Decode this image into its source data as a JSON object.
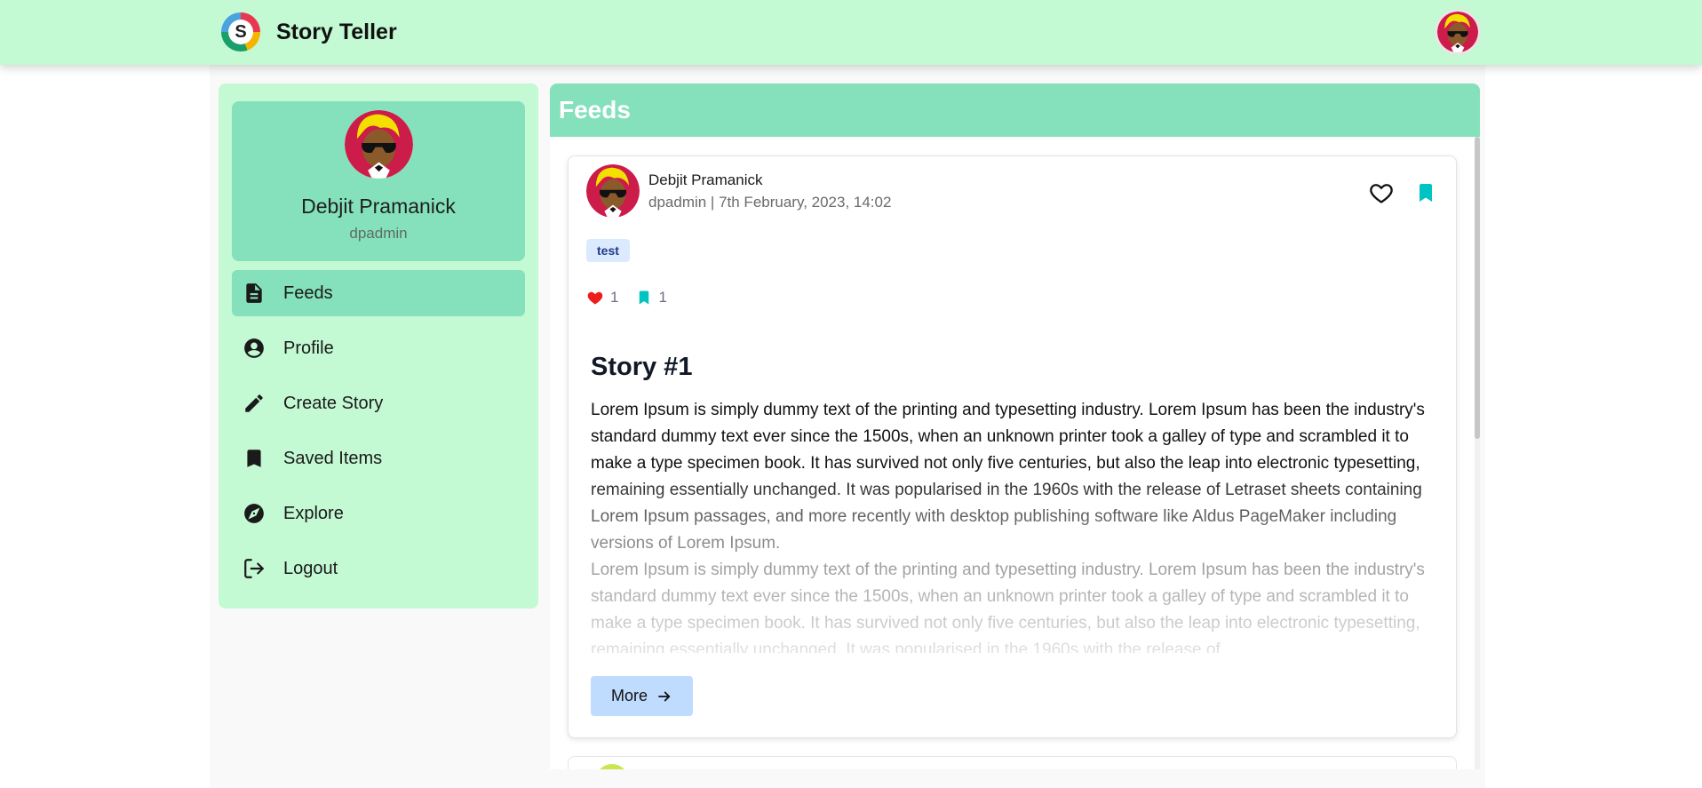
{
  "app": {
    "name": "Story Teller",
    "logo_letter": "S"
  },
  "user": {
    "name": "Debjit Pramanick",
    "username": "dpadmin"
  },
  "sidebar": {
    "items": [
      {
        "label": "Feeds",
        "icon": "document-icon",
        "active": true
      },
      {
        "label": "Profile",
        "icon": "account-circle-icon"
      },
      {
        "label": "Create Story",
        "icon": "pencil-icon"
      },
      {
        "label": "Saved Items",
        "icon": "bookmark-icon"
      },
      {
        "label": "Explore",
        "icon": "compass-icon"
      },
      {
        "label": "Logout",
        "icon": "logout-icon"
      }
    ]
  },
  "feeds": {
    "title": "Feeds",
    "stories": [
      {
        "author": "Debjit Pramanick",
        "meta": "dpadmin | 7th February, 2023, 14:02",
        "tag": "test",
        "likes": "1",
        "saves": "1",
        "title": "Story #1",
        "paragraphs": [
          "Lorem Ipsum is simply dummy text of the printing and typesetting industry. Lorem Ipsum has been the industry's standard dummy text ever since the 1500s, when an unknown printer took a galley of type and scrambled it to make a type specimen book. It has survived not only five centuries, but also the leap into electronic typesetting, remaining essentially unchanged. It was popularised in the 1960s with the release of Letraset sheets containing Lorem Ipsum passages, and more recently with desktop publishing software like Aldus PageMaker including versions of Lorem Ipsum.",
          "Lorem Ipsum is simply dummy text of the printing and typesetting industry. Lorem Ipsum has been the industry's standard dummy text ever since the 1500s, when an unknown printer took a galley of type and scrambled it to make a type specimen book. It has survived not only five centuries, but also the leap into electronic typesetting, remaining essentially unchanged. It was popularised in the 1960s with the release of"
        ],
        "more_label": "More"
      }
    ]
  },
  "colors": {
    "topbar": "#c3f9d3",
    "sidebar": "#c3f9d3",
    "accent": "#84e1bc",
    "like_red": "#ef1c1c",
    "bookmark_teal": "#00c4c4",
    "more_button": "#bfdbfe",
    "tag_bg": "#dbeafe"
  }
}
